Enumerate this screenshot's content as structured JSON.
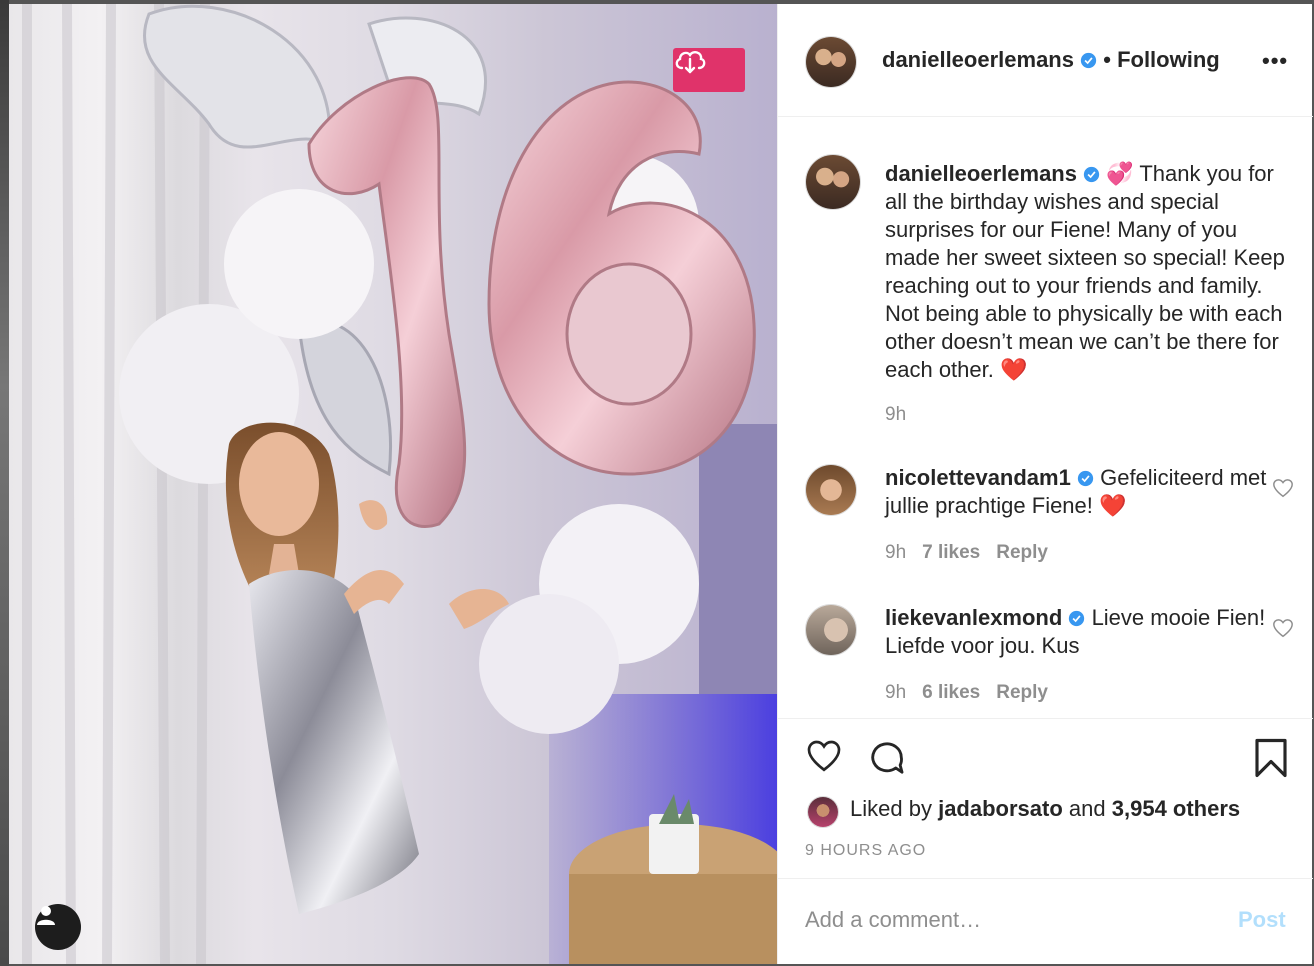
{
  "post": {
    "author": "danielleoerlemans",
    "follow_status": "Following",
    "more_label": "•••",
    "caption_emoji": "💞",
    "caption": "Thank you for all the birthday wishes and special surprises for our Fiene! Many of you made her sweet sixteen so special! Keep reaching out to your friends and family. Not being able to physically be with each other doesn’t mean we can’t be there for each other. ❤️",
    "caption_time": "9h",
    "photo_number": "16"
  },
  "comments": [
    {
      "user": "nicolettevandam1",
      "text": "Gefeliciteerd met jullie prachtige Fiene! ❤️",
      "time": "9h",
      "likes": "7 likes",
      "reply": "Reply"
    },
    {
      "user": "liekevanlexmond",
      "text": "Lieve mooie Fien! Liefde voor jou. Kus",
      "time": "9h",
      "likes": "6 likes",
      "reply": "Reply"
    }
  ],
  "likes": {
    "prefix": "Liked by",
    "user": "jadaborsato",
    "and": "and",
    "count": "3,954 others"
  },
  "timestamp": "9 HOURS AGO",
  "add_comment": {
    "placeholder": "Add a comment…",
    "post_label": "Post"
  },
  "colors": {
    "accent": "#0095f6",
    "download_button": "#e0336a",
    "heart": "#ed4956"
  },
  "icons": [
    "download-cloud-icon",
    "user-icon",
    "verified-icon",
    "heart-icon",
    "comment-icon",
    "bookmark-icon"
  ]
}
